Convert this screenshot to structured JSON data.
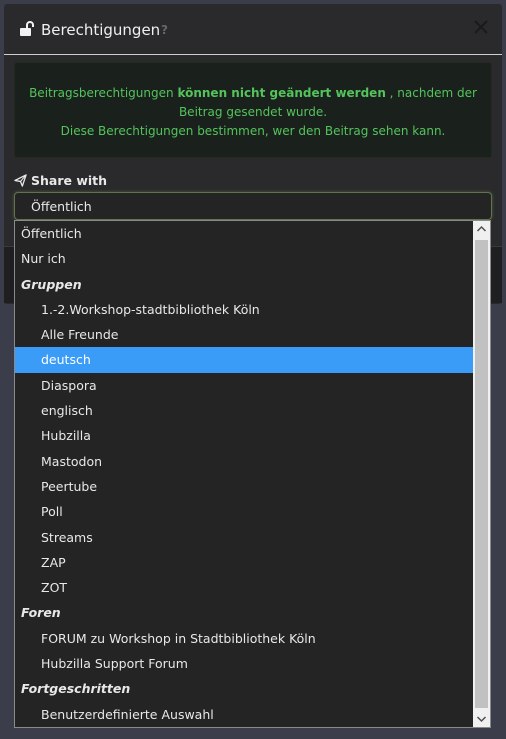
{
  "modal": {
    "title": "Berechtigungen",
    "help": "?",
    "close": "✕"
  },
  "alert": {
    "part1": "Beitragsberechtigungen ",
    "bold": "können nicht geändert werden",
    "part2": " , nachdem der Beitrag gesendet wurde.",
    "line2": "Diese Berechtigungen bestimmen, wer den Beitrag sehen kann."
  },
  "share": {
    "label": "Share with",
    "selected_value": "Öffentlich"
  },
  "dropdown": {
    "items": [
      {
        "label": "Öffentlich",
        "kind": "option"
      },
      {
        "label": "Nur ich",
        "kind": "option"
      },
      {
        "label": "Gruppen",
        "kind": "group"
      },
      {
        "label": "1.-2.Workshop-stadtbibliothek Köln",
        "kind": "sub"
      },
      {
        "label": "Alle Freunde",
        "kind": "sub"
      },
      {
        "label": "deutsch",
        "kind": "sub",
        "selected": true
      },
      {
        "label": "Diaspora",
        "kind": "sub"
      },
      {
        "label": "englisch",
        "kind": "sub"
      },
      {
        "label": "Hubzilla",
        "kind": "sub"
      },
      {
        "label": "Mastodon",
        "kind": "sub"
      },
      {
        "label": "Peertube",
        "kind": "sub"
      },
      {
        "label": "Poll",
        "kind": "sub"
      },
      {
        "label": "Streams",
        "kind": "sub"
      },
      {
        "label": "ZAP",
        "kind": "sub"
      },
      {
        "label": "ZOT",
        "kind": "sub"
      },
      {
        "label": "Foren",
        "kind": "group"
      },
      {
        "label": "FORUM zu Workshop in Stadtbibliothek Köln",
        "kind": "sub"
      },
      {
        "label": "Hubzilla Support Forum",
        "kind": "sub"
      },
      {
        "label": "Fortgeschritten",
        "kind": "group"
      },
      {
        "label": "Benutzerdefinierte Auswahl",
        "kind": "sub"
      }
    ]
  },
  "colors": {
    "highlight": "#3b9cf8",
    "alert_text": "#54c35c",
    "background": "#3b3e4a"
  },
  "icons": {
    "header": "unlock-icon",
    "share": "paper-plane-icon",
    "close": "close-icon",
    "help": "help-icon"
  }
}
